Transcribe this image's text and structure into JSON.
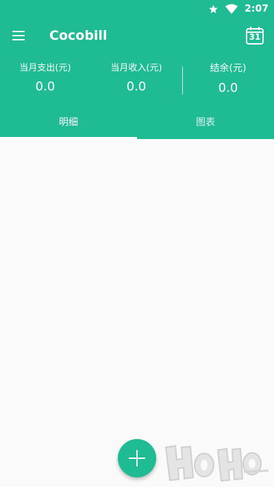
{
  "status_bar": {
    "time": "2:07",
    "icons": [
      "star-icon",
      "wifi-icon"
    ]
  },
  "toolbar": {
    "title": "Cocobill",
    "menu_icon": "menu-icon",
    "calendar_icon": "calendar-icon",
    "calendar_day": "31"
  },
  "summary": {
    "expense_label": "当月支出(元)",
    "expense_value": "0.0",
    "income_label": "当月收入(元)",
    "income_value": "0.0",
    "balance_label": "结余(元)",
    "balance_value": "0.0"
  },
  "tabs": [
    {
      "label": "明细",
      "selected": true
    },
    {
      "label": "图表",
      "selected": false
    }
  ],
  "fab": {
    "icon": "plus-icon"
  },
  "colors": {
    "primary": "#1fbb93",
    "background": "#fafafa",
    "on_primary": "#ffffff"
  }
}
